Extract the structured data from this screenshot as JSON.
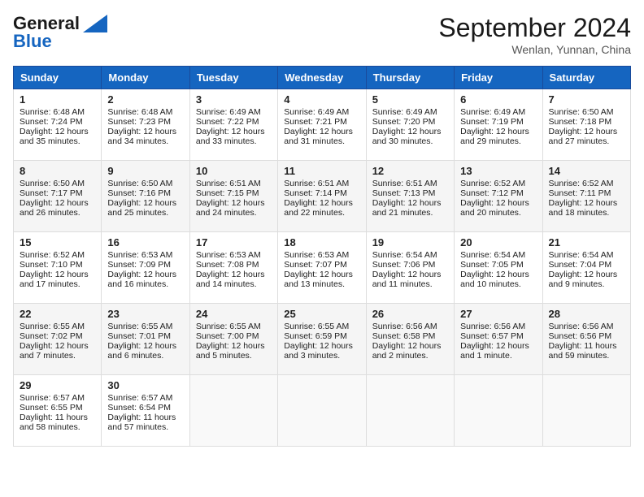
{
  "header": {
    "logo_line1": "General",
    "logo_line2": "Blue",
    "month_title": "September 2024",
    "location": "Wenlan, Yunnan, China"
  },
  "days_of_week": [
    "Sunday",
    "Monday",
    "Tuesday",
    "Wednesday",
    "Thursday",
    "Friday",
    "Saturday"
  ],
  "weeks": [
    [
      {
        "day": "1",
        "info": "Sunrise: 6:48 AM\nSunset: 7:24 PM\nDaylight: 12 hours and 35 minutes."
      },
      {
        "day": "2",
        "info": "Sunrise: 6:48 AM\nSunset: 7:23 PM\nDaylight: 12 hours and 34 minutes."
      },
      {
        "day": "3",
        "info": "Sunrise: 6:49 AM\nSunset: 7:22 PM\nDaylight: 12 hours and 33 minutes."
      },
      {
        "day": "4",
        "info": "Sunrise: 6:49 AM\nSunset: 7:21 PM\nDaylight: 12 hours and 31 minutes."
      },
      {
        "day": "5",
        "info": "Sunrise: 6:49 AM\nSunset: 7:20 PM\nDaylight: 12 hours and 30 minutes."
      },
      {
        "day": "6",
        "info": "Sunrise: 6:49 AM\nSunset: 7:19 PM\nDaylight: 12 hours and 29 minutes."
      },
      {
        "day": "7",
        "info": "Sunrise: 6:50 AM\nSunset: 7:18 PM\nDaylight: 12 hours and 27 minutes."
      }
    ],
    [
      {
        "day": "8",
        "info": "Sunrise: 6:50 AM\nSunset: 7:17 PM\nDaylight: 12 hours and 26 minutes."
      },
      {
        "day": "9",
        "info": "Sunrise: 6:50 AM\nSunset: 7:16 PM\nDaylight: 12 hours and 25 minutes."
      },
      {
        "day": "10",
        "info": "Sunrise: 6:51 AM\nSunset: 7:15 PM\nDaylight: 12 hours and 24 minutes."
      },
      {
        "day": "11",
        "info": "Sunrise: 6:51 AM\nSunset: 7:14 PM\nDaylight: 12 hours and 22 minutes."
      },
      {
        "day": "12",
        "info": "Sunrise: 6:51 AM\nSunset: 7:13 PM\nDaylight: 12 hours and 21 minutes."
      },
      {
        "day": "13",
        "info": "Sunrise: 6:52 AM\nSunset: 7:12 PM\nDaylight: 12 hours and 20 minutes."
      },
      {
        "day": "14",
        "info": "Sunrise: 6:52 AM\nSunset: 7:11 PM\nDaylight: 12 hours and 18 minutes."
      }
    ],
    [
      {
        "day": "15",
        "info": "Sunrise: 6:52 AM\nSunset: 7:10 PM\nDaylight: 12 hours and 17 minutes."
      },
      {
        "day": "16",
        "info": "Sunrise: 6:53 AM\nSunset: 7:09 PM\nDaylight: 12 hours and 16 minutes."
      },
      {
        "day": "17",
        "info": "Sunrise: 6:53 AM\nSunset: 7:08 PM\nDaylight: 12 hours and 14 minutes."
      },
      {
        "day": "18",
        "info": "Sunrise: 6:53 AM\nSunset: 7:07 PM\nDaylight: 12 hours and 13 minutes."
      },
      {
        "day": "19",
        "info": "Sunrise: 6:54 AM\nSunset: 7:06 PM\nDaylight: 12 hours and 11 minutes."
      },
      {
        "day": "20",
        "info": "Sunrise: 6:54 AM\nSunset: 7:05 PM\nDaylight: 12 hours and 10 minutes."
      },
      {
        "day": "21",
        "info": "Sunrise: 6:54 AM\nSunset: 7:04 PM\nDaylight: 12 hours and 9 minutes."
      }
    ],
    [
      {
        "day": "22",
        "info": "Sunrise: 6:55 AM\nSunset: 7:02 PM\nDaylight: 12 hours and 7 minutes."
      },
      {
        "day": "23",
        "info": "Sunrise: 6:55 AM\nSunset: 7:01 PM\nDaylight: 12 hours and 6 minutes."
      },
      {
        "day": "24",
        "info": "Sunrise: 6:55 AM\nSunset: 7:00 PM\nDaylight: 12 hours and 5 minutes."
      },
      {
        "day": "25",
        "info": "Sunrise: 6:55 AM\nSunset: 6:59 PM\nDaylight: 12 hours and 3 minutes."
      },
      {
        "day": "26",
        "info": "Sunrise: 6:56 AM\nSunset: 6:58 PM\nDaylight: 12 hours and 2 minutes."
      },
      {
        "day": "27",
        "info": "Sunrise: 6:56 AM\nSunset: 6:57 PM\nDaylight: 12 hours and 1 minute."
      },
      {
        "day": "28",
        "info": "Sunrise: 6:56 AM\nSunset: 6:56 PM\nDaylight: 11 hours and 59 minutes."
      }
    ],
    [
      {
        "day": "29",
        "info": "Sunrise: 6:57 AM\nSunset: 6:55 PM\nDaylight: 11 hours and 58 minutes."
      },
      {
        "day": "30",
        "info": "Sunrise: 6:57 AM\nSunset: 6:54 PM\nDaylight: 11 hours and 57 minutes."
      },
      {
        "day": "",
        "info": ""
      },
      {
        "day": "",
        "info": ""
      },
      {
        "day": "",
        "info": ""
      },
      {
        "day": "",
        "info": ""
      },
      {
        "day": "",
        "info": ""
      }
    ]
  ]
}
